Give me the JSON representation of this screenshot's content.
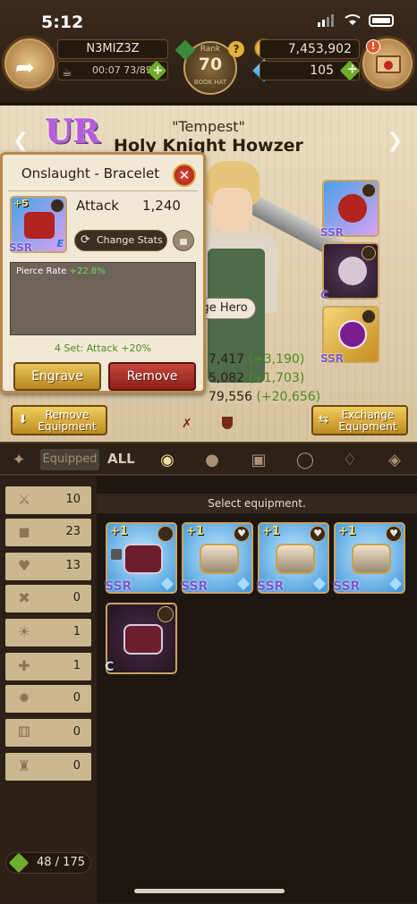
{
  "status": {
    "time": "5:12"
  },
  "header": {
    "player_name": "N3MIZ3Z",
    "stamina": "00:07 73/89",
    "rank_label": "Rank",
    "rank_value": "70",
    "rank_sub": "BOOK HAT",
    "gold": "7,453,902",
    "gems": "105",
    "mail_alert": "!"
  },
  "hero": {
    "rarity": "UR",
    "alias": "\"Tempest\"",
    "name": "Holy Knight Howzer",
    "change_hero_label": "nge Hero",
    "stats": [
      {
        "value": "7,417",
        "bonus": "(+3,190)"
      },
      {
        "value": "5,082",
        "bonus": "(+1,703)"
      },
      {
        "value": "79,556",
        "bonus": "(+20,656)"
      }
    ]
  },
  "detail_popup": {
    "title": "Onslaught - Bracelet",
    "enhance": "+5",
    "rarity": "SSR",
    "grade": "E",
    "stat_name": "Attack",
    "stat_value": "1,240",
    "change_stats_label": "Change Stats",
    "substat_label": "Pierce Rate",
    "substat_value": "+22.8%",
    "set_bonus": "4 Set: Attack +20%",
    "engrave_label": "Engrave",
    "remove_label": "Remove"
  },
  "equipment_slots": [
    {
      "rarity": "SSR",
      "icon": "bracelet-red"
    },
    {
      "rarity": "C",
      "icon": "crest-dark"
    },
    {
      "rarity": "SSR",
      "icon": "bowtie-purple"
    }
  ],
  "actions": {
    "remove_equipment": "Remove Equipment",
    "exchange_equipment": "Exchange Equipment"
  },
  "filters": {
    "equipped": "Equipped",
    "all": "ALL"
  },
  "stat_filters": [
    {
      "icon": "sword",
      "count": "10"
    },
    {
      "icon": "shield",
      "count": "23"
    },
    {
      "icon": "heart",
      "count": "13"
    },
    {
      "icon": "pierce",
      "count": "0"
    },
    {
      "icon": "resistance",
      "count": "1"
    },
    {
      "icon": "regen",
      "count": "1"
    },
    {
      "icon": "crit",
      "count": "0"
    },
    {
      "icon": "dice",
      "count": "0"
    },
    {
      "icon": "crown",
      "count": "0"
    }
  ],
  "inventory": {
    "header": "Select equipment.",
    "count": "48 / 175",
    "items": [
      {
        "enhance": "+1",
        "rarity": "SSR",
        "corner": "shield",
        "locked": true,
        "style": "dark-on-blue"
      },
      {
        "enhance": "+1",
        "rarity": "SSR",
        "corner": "heart",
        "locked": false,
        "style": "gauntlet"
      },
      {
        "enhance": "+1",
        "rarity": "SSR",
        "corner": "heart",
        "locked": false,
        "style": "gauntlet"
      },
      {
        "enhance": "+1",
        "rarity": "SSR",
        "corner": "heart",
        "locked": false,
        "style": "gauntlet"
      },
      {
        "enhance": "",
        "rarity": "C",
        "corner": "shield",
        "locked": false,
        "style": "dark"
      }
    ]
  },
  "colors": {
    "accent_gold": "#e9c65a",
    "danger_red": "#c6463a",
    "bonus_green": "#4f8b22",
    "panel_bg": "#f1e8d6"
  }
}
